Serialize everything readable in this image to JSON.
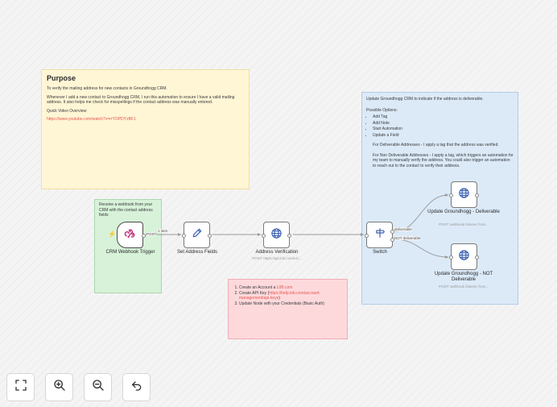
{
  "notes": {
    "purpose": {
      "title": "Purpose",
      "line1": "To verify the mailing address for new contacts in Groundhogg CRM.",
      "line2": "Whenever I add a new contact to Groundhogg CRM, I run this automation to ensure I have a valid mailing address. It also helps me check for misspellings if the contact address was manually entered.",
      "video_label": "Quick Video Overview:",
      "video_url": "https://www.youtube.com/watch?v=rrYOPDYzBF1"
    },
    "webhook": {
      "text": "Receive a webhook from your CRM with the contact address fields"
    },
    "update": {
      "intro": "Update Groundhogg CRM to indicate if the address is deliverable.",
      "options_label": "Possible Options:",
      "options": [
        "Add Tag",
        "Add Note",
        "Start Automation",
        "Update a Field"
      ],
      "deliverable": "For Deliverable Addresses - I apply a tag that the address was verified.",
      "non_deliverable": "For Non Deliverable Addresses - I apply a tag, which triggers an automation for my team to manually verify the address. You could also trigger an automation to reach out to the contact to verify their address."
    },
    "steps": {
      "step1_prefix": "Create an Account a ",
      "step1_link": "L0B.com",
      "step2_prefix": "Create API Key (",
      "step2_link": "https://help.lob.com/account-management/api-keys",
      "step2_suffix": ")",
      "step3": "Update Node with your Credentials (Basic Auth)"
    }
  },
  "nodes": {
    "trigger": {
      "label": "CRM Webhook Trigger",
      "icon": "webhook-icon",
      "out_label": "POST"
    },
    "set_fields": {
      "label": "Set Address Fields",
      "icon": "pencil-icon"
    },
    "verify": {
      "label": "Address Verification",
      "subtitle": "POST: https://api.lob.com/v1/...",
      "icon": "globe-icon"
    },
    "switch": {
      "label": "Switch",
      "icon": "switch-icon"
    },
    "deliverable": {
      "label": "Update Groundhogg - Deliverable",
      "subtitle": "POST: webhook listener from...",
      "icon": "globe-icon"
    },
    "not_deliverable": {
      "label": "Update Groundhogg - NOT Deliverable",
      "subtitle": "POST: webhook listener from...",
      "icon": "globe-icon"
    }
  },
  "edges": {
    "trigger_items": "1 item",
    "deliverable": "deliverable",
    "not_deliverable": "NOT deliverable"
  },
  "colors": {
    "accent": "#e8554f",
    "trigger_bolt": "#ef6c45",
    "icon_blue": "#3b5fb0",
    "purpose_bg": "#fff6d6",
    "webhook_bg": "#d7f2d9",
    "update_bg": "#dceaf8",
    "steps_bg": "#fdd9dc"
  },
  "controls": [
    "fit-view-icon",
    "zoom-in-icon",
    "zoom-out-icon",
    "undo-icon"
  ]
}
